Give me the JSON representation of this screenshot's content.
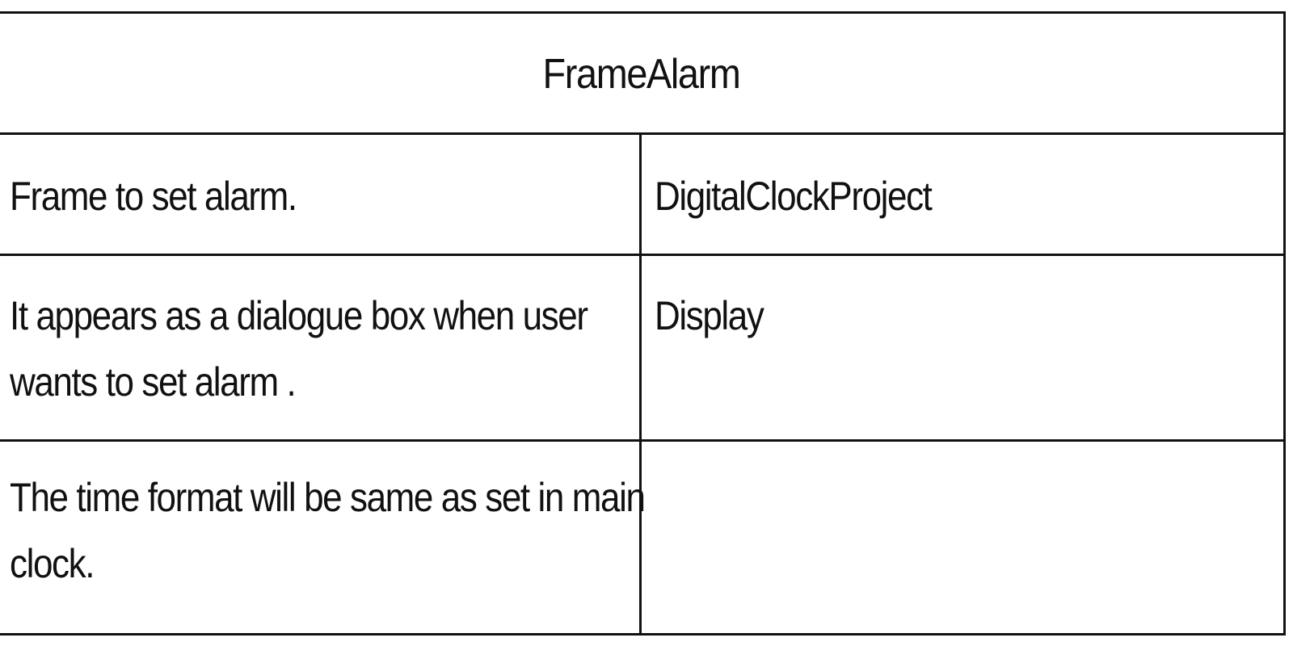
{
  "card": {
    "title": "FrameAlarm",
    "responsibilities": [
      [
        "Frame to set alarm."
      ],
      [
        "It appears as a dialogue box when user",
        "wants to set alarm ."
      ],
      [
        "The time format will be same as set in main",
        "clock."
      ]
    ],
    "collaborators": [
      "DigitalClockProject",
      "Display",
      ""
    ]
  }
}
